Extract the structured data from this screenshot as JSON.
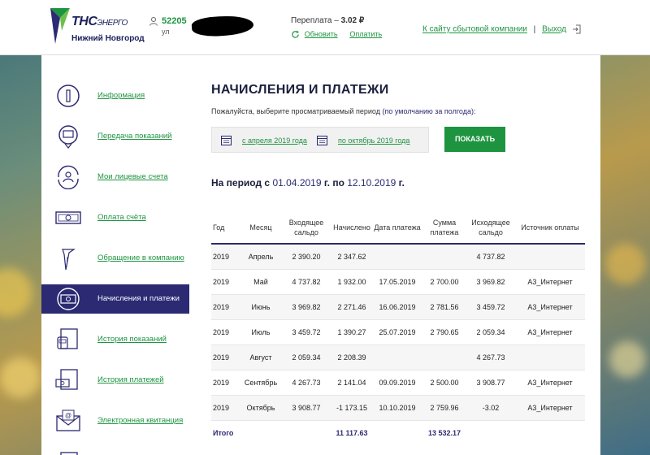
{
  "header": {
    "logo_brand": "ТНС",
    "logo_brand_suffix": "ЭНЕРГО",
    "logo_city": "Нижний Новгород",
    "account_number": "52205",
    "account_address": "ул",
    "balance_label": "Переплата –",
    "balance_value": "3.02 ₽",
    "refresh_label": "Обновить",
    "pay_label": "Оплатить",
    "company_site_link": "К сайту сбытовой компании",
    "separator": "|",
    "exit_link": "Выход"
  },
  "sidebar": {
    "items": [
      {
        "label": "Информация",
        "icon": "info-icon"
      },
      {
        "label": "Передача показаний",
        "icon": "meter-icon"
      },
      {
        "label": "Мои лицевые счета",
        "icon": "user-account-icon"
      },
      {
        "label": "Оплата счёта",
        "icon": "banknote-icon"
      },
      {
        "label": "Обращение в компанию",
        "icon": "pen-icon"
      },
      {
        "label": "Начисления и платежи",
        "icon": "charges-icon",
        "active": true
      },
      {
        "label": "История показаний",
        "icon": "readings-history-icon"
      },
      {
        "label": "История платежей",
        "icon": "payments-history-icon"
      },
      {
        "label": "Электронная квитанция",
        "icon": "email-receipt-icon"
      }
    ]
  },
  "content": {
    "title": "НАЧИСЛЕНИЯ И ПЛАТЕЖИ",
    "hint": "Пожалуйста, выберите просматриваемый период",
    "hint_default": "(по умолчанию за полгода):",
    "date_from": "с апреля 2019 года",
    "date_to": "по октябрь 2019 года",
    "show_button": "ПОКАЗАТЬ",
    "period_prefix": "На период с",
    "period_from": "01.04.2019",
    "period_mid": "г. по",
    "period_to": "12.10.2019",
    "period_suffix": "г."
  },
  "table": {
    "headers": [
      "Год",
      "Месяц",
      "Входящее сальдо",
      "Начислено",
      "Дата платежа",
      "Сумма платежа",
      "Исходящее сальдо",
      "Источник оплаты"
    ],
    "rows": [
      [
        "2019",
        "Апрель",
        "2 390.20",
        "2 347.62",
        "",
        "",
        "4 737.82",
        ""
      ],
      [
        "2019",
        "Май",
        "4 737.82",
        "1 932.00",
        "17.05.2019",
        "2 700.00",
        "3 969.82",
        "А3_Интернет"
      ],
      [
        "2019",
        "Июнь",
        "3 969.82",
        "2 271.46",
        "16.06.2019",
        "2 781.56",
        "3 459.72",
        "А3_Интернет"
      ],
      [
        "2019",
        "Июль",
        "3 459.72",
        "1 390.27",
        "25.07.2019",
        "2 790.65",
        "2 059.34",
        "А3_Интернет"
      ],
      [
        "2019",
        "Август",
        "2 059.34",
        "2 208.39",
        "",
        "",
        "4 267.73",
        ""
      ],
      [
        "2019",
        "Сентябрь",
        "4 267.73",
        "2 141.04",
        "09.09.2019",
        "2 500.00",
        "3 908.77",
        "А3_Интернет"
      ],
      [
        "2019",
        "Октябрь",
        "3 908.77",
        "-1 173.15",
        "10.10.2019",
        "2 759.96",
        "-3.02",
        "А3_Интернет"
      ]
    ],
    "total": [
      "Итого",
      "",
      "",
      "11 117.63",
      "",
      "13 532.17",
      "",
      ""
    ]
  },
  "colors": {
    "brand_green": "#1e9440",
    "brand_navy": "#2b2a73"
  }
}
